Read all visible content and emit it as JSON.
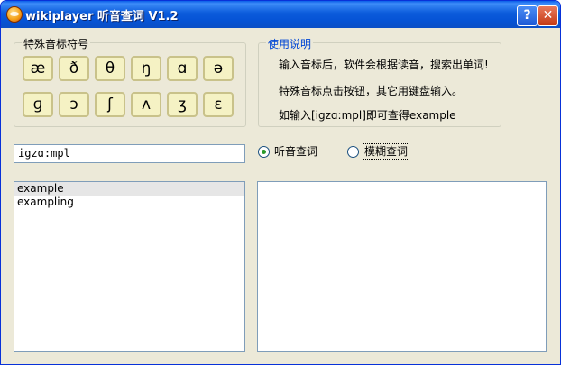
{
  "window": {
    "title": "wikiplayer 听音查词 V1.2",
    "help_label": "?",
    "close_label": "✕"
  },
  "symbols": {
    "legend": "特殊音标符号",
    "items": [
      "æ",
      "ð",
      "θ",
      "ŋ",
      "ɑ",
      "ə",
      "ɡ",
      "ɔ",
      "ʃ",
      "ʌ",
      "ʒ",
      "ɛ"
    ]
  },
  "usage": {
    "legend": "使用说明",
    "lines": [
      "输入音标后，软件会根据读音，搜索出单词!",
      "特殊音标点击按钮，其它用键盘输入。",
      "如输入[igzɑ:mpl]即可查得example"
    ]
  },
  "query": {
    "value": "igzɑ:mpl"
  },
  "search_mode": {
    "options": [
      {
        "label": "听音查词",
        "selected": true
      },
      {
        "label": "模糊查词",
        "selected": false
      }
    ]
  },
  "results": {
    "items": [
      "example",
      "exampling"
    ],
    "selected_index": 0
  },
  "detail": {
    "text": ""
  },
  "colors": {
    "titlebar": "#0a5fe8",
    "window_bg": "#ece9d8",
    "symbol_button_bg": "#f5f2c4",
    "usage_legend": "#0046d5"
  }
}
